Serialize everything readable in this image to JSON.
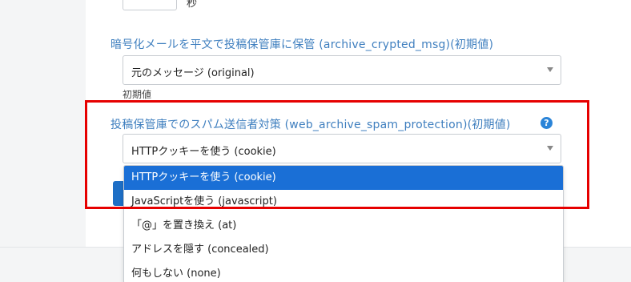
{
  "top_field": {
    "unit": "秒"
  },
  "archive_crypted_msg": {
    "label": "暗号化メールを平文で投稿保管庫に保管 (archive_crypted_msg)(初期値)",
    "value": "元のメッセージ (original)",
    "note": "初期値"
  },
  "web_archive_spam_protection": {
    "label": "投稿保管庫でのスパム送信者対策 (web_archive_spam_protection)(初期値)",
    "value": "HTTPクッキーを使う (cookie)",
    "help_icon": "?",
    "options": [
      "HTTPクッキーを使う (cookie)",
      "JavaScriptを使う (javascript)",
      "「@」を置き換え (at)",
      "アドレスを隠す (concealed)",
      "何もしない (none)"
    ],
    "selected_index": 0
  },
  "colors": {
    "label": "#3f7fbf",
    "selected_option": "#1a6fd6",
    "highlight": "#e60000",
    "help_icon": "#2a84d8"
  }
}
